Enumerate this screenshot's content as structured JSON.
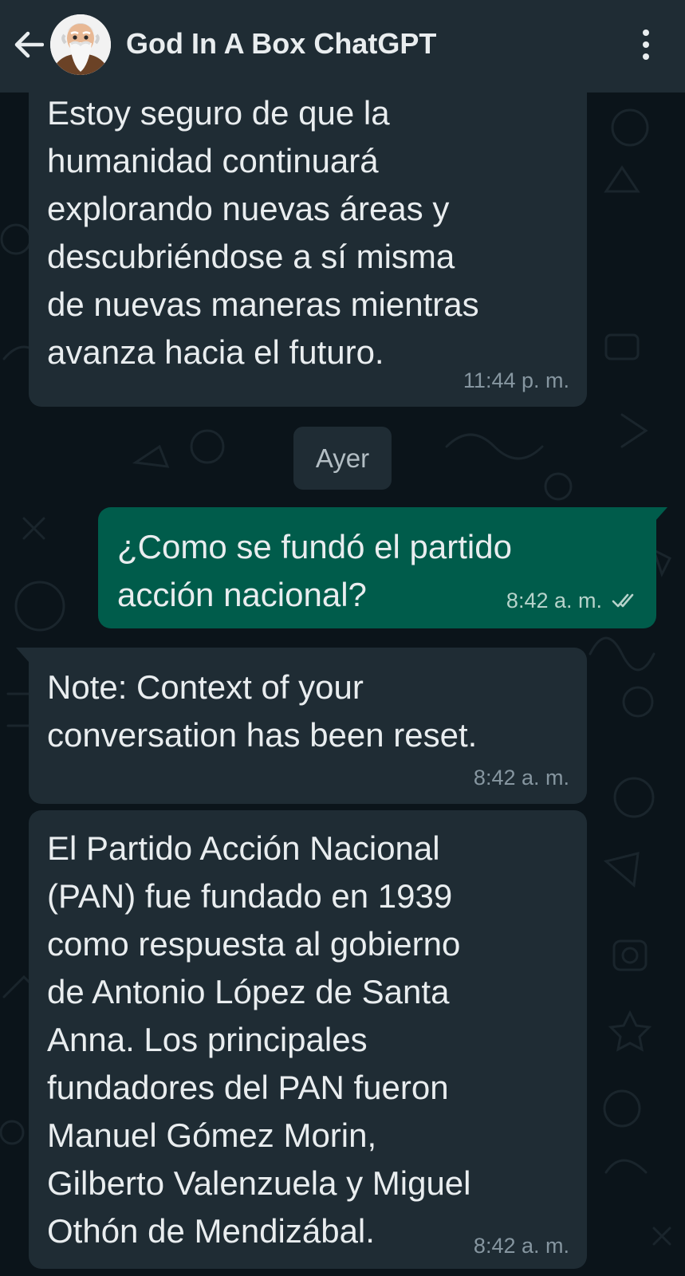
{
  "header": {
    "title": "God In A Box ChatGPT",
    "back_icon": "arrow-left-icon",
    "menu_icon": "more-vertical-icon",
    "avatar_icon": "bearded-old-man-avatar"
  },
  "colors": {
    "background": "#0b141a",
    "header": "#1f2c34",
    "incoming_bubble": "#1f2c34",
    "outgoing_bubble": "#005c4b",
    "text": "#e9edef",
    "meta_text": "#8696a0"
  },
  "messages": [
    {
      "direction": "incoming",
      "text": "Estoy seguro de que la\nhumanidad continuará\nexplorando nuevas áreas y\ndescubriéndose a sí misma\nde nuevas maneras mientras\navanza hacia el futuro.",
      "time": "11:44 p. m."
    },
    {
      "direction": "outgoing",
      "text": "¿Como se fundó el partido\nacción nacional?",
      "time": "8:42 a. m.",
      "status_icon": "double-check-icon"
    },
    {
      "direction": "incoming",
      "text": "Note: Context of your\nconversation has been reset.",
      "time": "8:42 a. m."
    },
    {
      "direction": "incoming",
      "text": "El Partido Acción Nacional\n(PAN) fue fundado en 1939\ncomo respuesta al gobierno\nde Antonio López de Santa\nAnna. Los principales\nfundadores del PAN fueron\nManuel Gómez Morin,\nGilberto Valenzuela y Miguel\nOthón de Mendizábal.",
      "time": "8:42 a. m."
    }
  ],
  "date_separator": "Ayer"
}
